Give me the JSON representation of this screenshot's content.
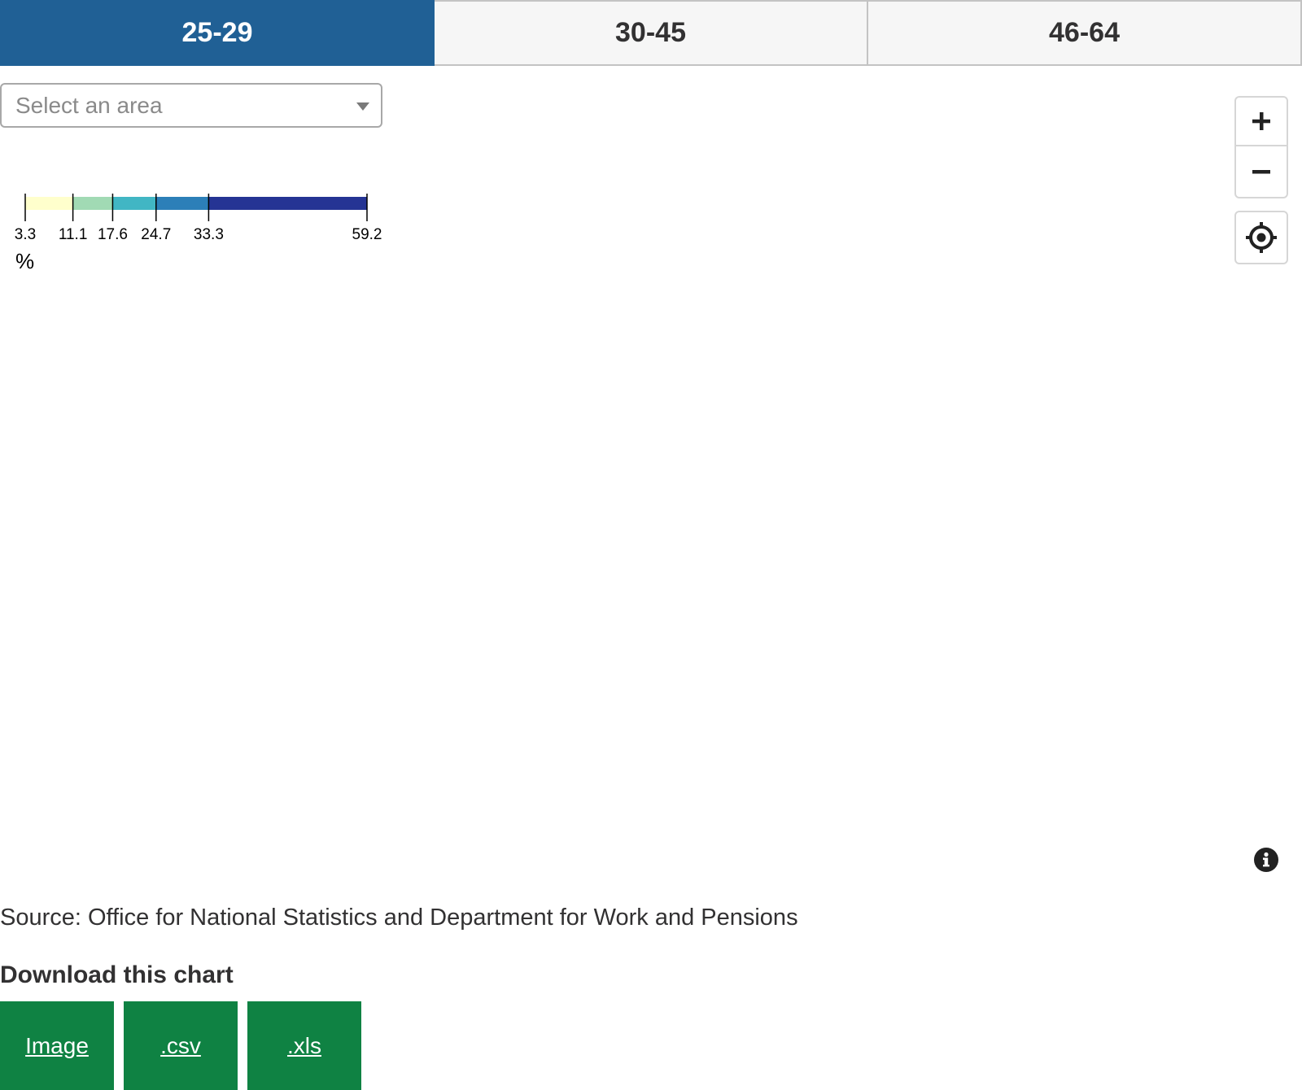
{
  "tabs": [
    {
      "label": "25-29",
      "active": true
    },
    {
      "label": "30-45",
      "active": false
    },
    {
      "label": "46-64",
      "active": false
    }
  ],
  "area_select": {
    "placeholder": "Select an area"
  },
  "legend": {
    "breaks": [
      3.3,
      11.1,
      17.6,
      24.7,
      33.3,
      59.2
    ],
    "break_labels": [
      "3.3",
      "11.1",
      "17.6",
      "24.7",
      "33.3",
      "59.2"
    ],
    "colors": [
      "#ffffcc",
      "#a1dab4",
      "#41b6c4",
      "#2c7fb8",
      "#253494"
    ],
    "unit": "%"
  },
  "map_controls": {
    "zoom_in_icon": "plus-icon",
    "zoom_out_icon": "minus-icon",
    "locate_icon": "crosshair-icon",
    "info_icon": "info-icon"
  },
  "source": "Source: Office for National Statistics and Department for Work and Pensions",
  "download": {
    "title": "Download this chart",
    "buttons": [
      "Image",
      ".csv",
      ".xls"
    ]
  },
  "colors": {
    "active_tab": "#206095",
    "download_button": "#0f8243"
  }
}
